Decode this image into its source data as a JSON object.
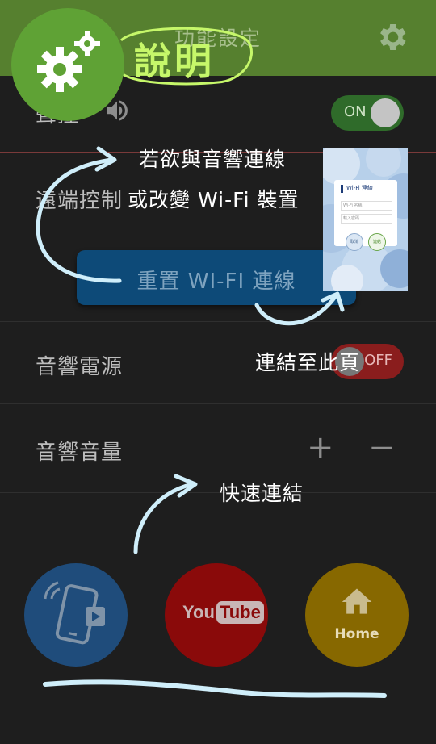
{
  "header": {
    "title": "功能設定"
  },
  "rows": [
    {
      "label": "聲控",
      "toggle": "ON"
    },
    {
      "label": "遠端控制"
    },
    {
      "label": "音響電源",
      "toggle": "OFF"
    },
    {
      "label": "音響音量",
      "plus": "+",
      "minus": "−"
    }
  ],
  "reset_button": {
    "label": "重置 WI-FI 連線"
  },
  "quick_links": [
    {
      "name": "remote-app",
      "icon": "phone-play-icon"
    },
    {
      "name": "youtube",
      "label_you": "You",
      "label_tube": "Tube"
    },
    {
      "name": "home",
      "label": "Home"
    }
  ],
  "annotations": {
    "help_title": "說明",
    "line1": "若欲與音響連線",
    "line2": "或改變 Wi-Fi 裝置",
    "link_page": "連結至此頁",
    "quick_link": "快速連結"
  },
  "thumbnail": {
    "title": "Wi-Fi 連線",
    "field1": "Wi-Fi 名稱",
    "field2": "輸入密碼",
    "btn1": "取消",
    "btn2": "連結"
  },
  "colors": {
    "header_green": "#56802f",
    "toggle_on": "#2f6b2a",
    "toggle_off": "#8a1d1d",
    "reset_blue": "#0d4a78",
    "annotation": "#cfeefa"
  }
}
